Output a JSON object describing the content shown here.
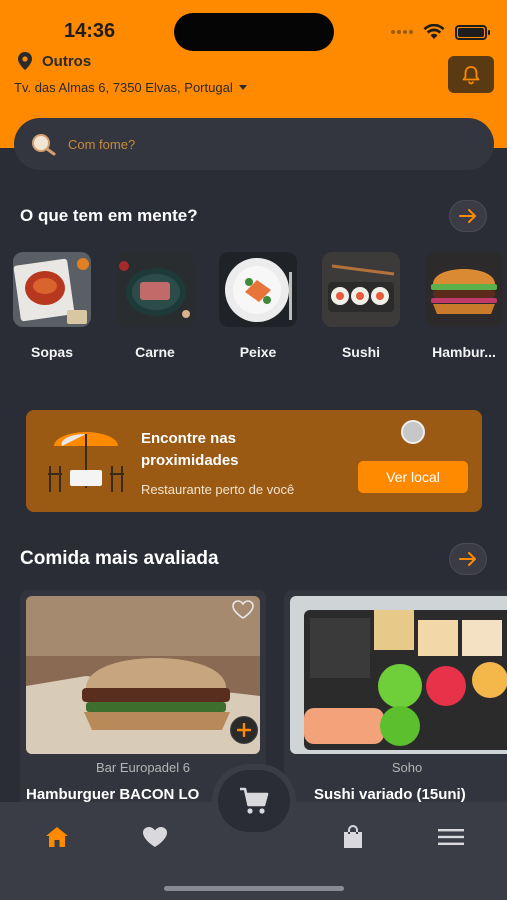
{
  "status": {
    "time": "14:36"
  },
  "header": {
    "location_label": "Outros",
    "address": "Tv. das Almas 6, 7350 Elvas, Portugal"
  },
  "search": {
    "placeholder": "Com fome?"
  },
  "categories_section": {
    "title": "O que tem em mente?",
    "items": [
      {
        "label": "Sopas"
      },
      {
        "label": "Carne"
      },
      {
        "label": "Peixe"
      },
      {
        "label": "Sushi"
      },
      {
        "label": "Hambur..."
      }
    ]
  },
  "banner": {
    "title": "Encontre nas proximidades",
    "subtitle": "Restaurante perto de você",
    "button_label": "Ver local"
  },
  "top_rated_section": {
    "title": "Comida mais avaliada",
    "cards": [
      {
        "store": "Bar Europadel 6",
        "name": "Hamburguer BACON LO"
      },
      {
        "store": "Soho",
        "name": "Sushi variado (15uni)"
      }
    ]
  },
  "nav": {
    "items": [
      {
        "icon": "home-icon",
        "active": true
      },
      {
        "icon": "heart-icon",
        "active": false
      },
      {
        "icon": "cart-icon",
        "active": false
      },
      {
        "icon": "bag-icon",
        "active": false
      },
      {
        "icon": "menu-icon",
        "active": false
      }
    ]
  },
  "colors": {
    "accent": "#ff8a00",
    "background": "#2a2c36",
    "banner": "#9a5a14"
  }
}
